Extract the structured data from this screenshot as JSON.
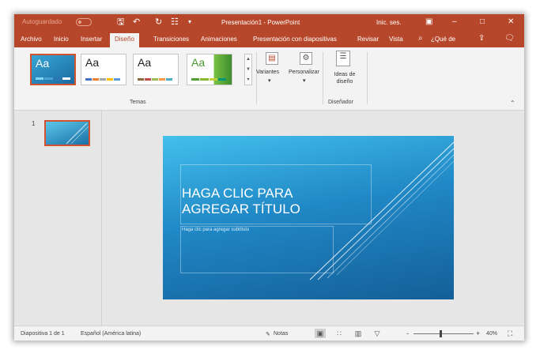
{
  "titlebar": {
    "autosave_label": "Autoguardado",
    "document_title": "Presentación1 - PowerPoint",
    "signin_label": "Inic. ses."
  },
  "tabs": [
    {
      "label": "Archivo"
    },
    {
      "label": "Inicio"
    },
    {
      "label": "Insertar"
    },
    {
      "label": "Diseño",
      "active": true
    },
    {
      "label": "Transiciones"
    },
    {
      "label": "Animaciones"
    },
    {
      "label": "Presentación con diapositivas"
    },
    {
      "label": "Revisar"
    },
    {
      "label": "Vista"
    },
    {
      "label": "¿Qué de"
    }
  ],
  "ribbon": {
    "themes_group_label": "Temas",
    "theme_tile_text": "Aa",
    "variants_label": "Variantes",
    "customize_label": "Personalizar",
    "design_ideas_label": "Ideas de diseño",
    "designer_group_label": "Diseñador"
  },
  "thumbnails": {
    "slide_number": "1"
  },
  "slide": {
    "title_placeholder": "HAGA CLIC PARA AGREGAR TÍTULO",
    "subtitle_placeholder": "Haga clic para agregar subtítulo"
  },
  "statusbar": {
    "slide_info": "Diapositiva 1 de 1",
    "language": "Español (América latina)",
    "notes_label": "Notas",
    "zoom_minus": "-",
    "zoom_plus": "+",
    "zoom_level": "40%"
  },
  "colors": {
    "accent": "#b7472a",
    "slide_gradient_start": "#43c0ec",
    "slide_gradient_end": "#145f98"
  }
}
